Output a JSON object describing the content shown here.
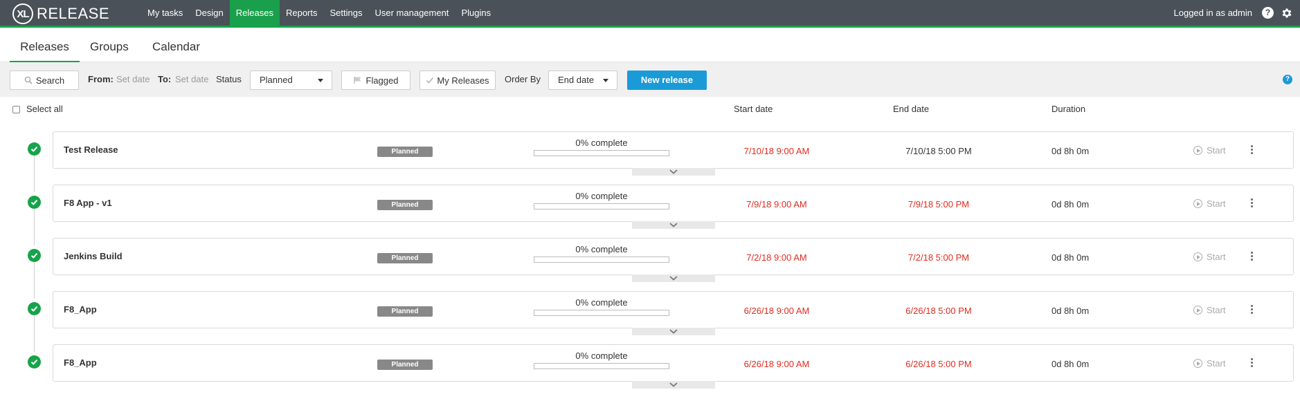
{
  "app": {
    "logo_mark": "XL",
    "logo_text": "RELEASE",
    "nav": [
      "My tasks",
      "Design",
      "Releases",
      "Reports",
      "Settings",
      "User management",
      "Plugins"
    ],
    "active_nav": "Releases",
    "user_text": "Logged in as admin",
    "help_glyph": "?",
    "accent_color": "#16a34a",
    "topbar_color": "#4a5158"
  },
  "subtabs": [
    "Releases",
    "Groups",
    "Calendar"
  ],
  "filters": {
    "search_label": "Search",
    "from_label": "From:",
    "from_placeholder": "Set date",
    "to_label": "To:",
    "to_placeholder": "Set date",
    "status_label": "Status",
    "status_value": "Planned",
    "flagged_label": "Flagged",
    "my_releases_label": "My Releases",
    "order_by_label": "Order By",
    "order_by_value": "End date",
    "new_release_label": "New release",
    "help_glyph": "?"
  },
  "table": {
    "select_all_label": "Select all",
    "columns": {
      "start": "Start date",
      "end": "End date",
      "duration": "Duration"
    }
  },
  "releases": [
    {
      "name": "Test Release",
      "status": "Planned",
      "progress_text": "0% complete",
      "progress": 0,
      "start": "7/10/18 9:00 AM",
      "end": "7/10/18 5:00 PM",
      "end_overdue": false,
      "duration": "0d 8h 0m",
      "action": "Start"
    },
    {
      "name": "F8 App - v1",
      "status": "Planned",
      "progress_text": "0% complete",
      "progress": 0,
      "start": "7/9/18 9:00 AM",
      "end": "7/9/18 5:00 PM",
      "end_overdue": true,
      "duration": "0d 8h 0m",
      "action": "Start"
    },
    {
      "name": "Jenkins Build",
      "status": "Planned",
      "progress_text": "0% complete",
      "progress": 0,
      "start": "7/2/18 9:00 AM",
      "end": "7/2/18 5:00 PM",
      "end_overdue": true,
      "duration": "0d 8h 0m",
      "action": "Start"
    },
    {
      "name": "F8_App",
      "status": "Planned",
      "progress_text": "0% complete",
      "progress": 0,
      "start": "6/26/18 9:00 AM",
      "end": "6/26/18 5:00 PM",
      "end_overdue": true,
      "duration": "0d 8h 0m",
      "action": "Start"
    },
    {
      "name": "F8_App",
      "status": "Planned",
      "progress_text": "0% complete",
      "progress": 0,
      "start": "6/26/18 9:00 AM",
      "end": "6/26/18 5:00 PM",
      "end_overdue": true,
      "duration": "0d 8h 0m",
      "action": "Start"
    }
  ]
}
